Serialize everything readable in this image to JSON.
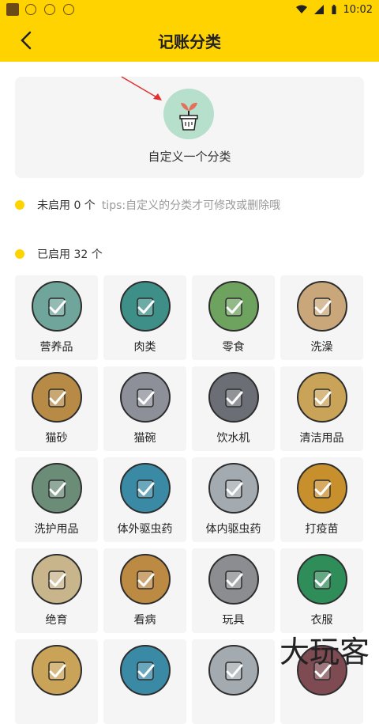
{
  "status_bar": {
    "time": "10:02"
  },
  "header": {
    "title": "记账分类"
  },
  "custom": {
    "label": "自定义一个分类"
  },
  "disabled": {
    "label": "未启用 0 个",
    "tip": "tips:自定义的分类才可修改或删除哦"
  },
  "enabled": {
    "label": "已启用 32 个"
  },
  "categories": [
    {
      "label": "营养品",
      "color": "#6fa59a",
      "icon": "jar-icon"
    },
    {
      "label": "肉类",
      "color": "#3d8f88",
      "icon": "pot-icon"
    },
    {
      "label": "零食",
      "color": "#6ea25f",
      "icon": "snack-jar-icon"
    },
    {
      "label": "洗澡",
      "color": "#c9a77b",
      "icon": "bathtub-icon"
    },
    {
      "label": "猫砂",
      "color": "#b78a45",
      "icon": "litter-icon"
    },
    {
      "label": "猫碗",
      "color": "#8d8f99",
      "icon": "bowl-icon"
    },
    {
      "label": "饮水机",
      "color": "#6b6f75",
      "icon": "water-dispenser-icon"
    },
    {
      "label": "清洁用品",
      "color": "#c9a358",
      "icon": "cleaning-bottle-icon"
    },
    {
      "label": "洗护用品",
      "color": "#6b8d78",
      "icon": "shampoo-icon"
    },
    {
      "label": "体外驱虫药",
      "color": "#3a8aa6",
      "icon": "flea-spray-icon"
    },
    {
      "label": "体内驱虫药",
      "color": "#a3aab0",
      "icon": "pill-icon"
    },
    {
      "label": "打疫苗",
      "color": "#c88f2d",
      "icon": "syringe-icon"
    },
    {
      "label": "绝育",
      "color": "#c9b58b",
      "icon": "scissors-icon"
    },
    {
      "label": "看病",
      "color": "#bd8a44",
      "icon": "clipboard-icon"
    },
    {
      "label": "玩具",
      "color": "#8b8d90",
      "icon": "toy-ball-icon"
    },
    {
      "label": "衣服",
      "color": "#2f8d5a",
      "icon": "clothes-icon"
    },
    {
      "label": "",
      "color": "#c9a358",
      "icon": "comb-icon"
    },
    {
      "label": "",
      "color": "#3a8aa6",
      "icon": "spray-icon"
    },
    {
      "label": "",
      "color": "#a3aab0",
      "icon": "brush-icon"
    },
    {
      "label": "",
      "color": "#7e4b52",
      "icon": "misc-icon"
    }
  ],
  "watermark": "大玩客"
}
